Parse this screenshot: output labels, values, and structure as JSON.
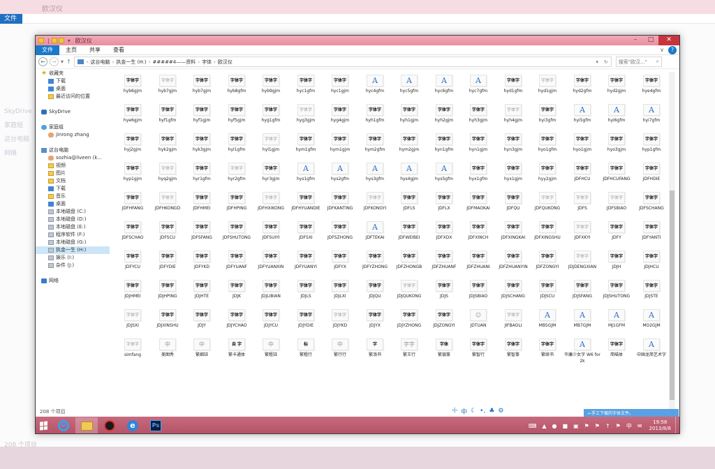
{
  "window": {
    "title": "欧汉仪",
    "controls": {
      "minimize": "–",
      "maximize": "□",
      "close": "✕"
    }
  },
  "ribbon": {
    "tabs": [
      "文件",
      "主页",
      "共享",
      "查看"
    ],
    "help": "?",
    "expand": "∨"
  },
  "address": {
    "crumbs": [
      "这台电脑",
      "执金一生 (H:)",
      "#####4——资料",
      "字体",
      "欧汉仪"
    ],
    "search_placeholder": "搜索\"欧汉...\""
  },
  "nav": {
    "favorites": {
      "label": "收藏夹",
      "items": [
        "下载",
        "桌面",
        "最近访问的位置"
      ]
    },
    "skydrive": "SkyDrive",
    "homegroup": {
      "label": "家庭组",
      "user": "jinrong zhang"
    },
    "thispc": {
      "label": "这台电脑",
      "items": [
        {
          "label": "sozhia@liveen (k...",
          "icon": "user"
        },
        {
          "label": "视频",
          "icon": "folder"
        },
        {
          "label": "图片",
          "icon": "folder"
        },
        {
          "label": "文档",
          "icon": "folder"
        },
        {
          "label": "下载",
          "icon": "blue"
        },
        {
          "label": "音乐",
          "icon": "folder"
        },
        {
          "label": "桌面",
          "icon": "blue"
        },
        {
          "label": "本地磁盘 (C:)",
          "icon": "drive"
        },
        {
          "label": "本地磁盘 (D:)",
          "icon": "drive"
        },
        {
          "label": "本地磁盘 (E:)",
          "icon": "drive"
        },
        {
          "label": "程序软件 (F:)",
          "icon": "drive"
        },
        {
          "label": "本地磁盘 (G:)",
          "icon": "drive"
        },
        {
          "label": "执金一生 (H:)",
          "icon": "drive",
          "selected": true
        },
        {
          "label": "娱乐 (I:)",
          "icon": "drive"
        },
        {
          "label": "杂件 (J:)",
          "icon": "drive"
        }
      ]
    },
    "network": "网络"
  },
  "files": [
    {
      "name": "hyb6gjm",
      "glyph": "字体字",
      "style": "bold"
    },
    {
      "name": "hyb7gjm",
      "glyph": "字体字",
      "style": "gray"
    },
    {
      "name": "hyb7gjm",
      "glyph": "字体字",
      "style": "bold"
    },
    {
      "name": "hyb8gfm",
      "glyph": "字体字",
      "style": "bold"
    },
    {
      "name": "hyb9gjm",
      "glyph": "字体字",
      "style": "bold"
    },
    {
      "name": "hyc1gfm",
      "glyph": "字体字",
      "style": "bold"
    },
    {
      "name": "hyc1gjm",
      "glyph": "字体字",
      "style": "bold"
    },
    {
      "name": "hyc4gfm",
      "glyph": "A",
      "style": "blue"
    },
    {
      "name": "hyc5gfm",
      "glyph": "A",
      "style": "blue"
    },
    {
      "name": "hyc6gfm",
      "glyph": "A",
      "style": "blue"
    },
    {
      "name": "hyc7gfm",
      "glyph": "A",
      "style": "blue"
    },
    {
      "name": "hyd1gfm",
      "glyph": "字体字",
      "style": "bold"
    },
    {
      "name": "hyd1gjm",
      "glyph": "字体字",
      "style": "gray"
    },
    {
      "name": "hyd2gfm",
      "glyph": "字体字",
      "style": "bold"
    },
    {
      "name": "hyd2gjm",
      "glyph": "字体字",
      "style": "bold"
    },
    {
      "name": "hye4gfm",
      "glyph": "字体字",
      "style": "bold"
    },
    {
      "name": "hye6gjm",
      "glyph": "字体字",
      "style": "bold"
    },
    {
      "name": "hyf1gfm",
      "glyph": "字体字",
      "style": "bold"
    },
    {
      "name": "hyf1gjm",
      "glyph": "字体字",
      "style": "bold"
    },
    {
      "name": "hyf5gjm",
      "glyph": "字体字",
      "style": "bold"
    },
    {
      "name": "hyg1gfm",
      "glyph": "字体字",
      "style": "bold"
    },
    {
      "name": "hyg3gjm",
      "glyph": "字体字",
      "style": "gray"
    },
    {
      "name": "hyg4gjm",
      "glyph": "字体字",
      "style": "bold"
    },
    {
      "name": "hyh1gfm",
      "glyph": "字体字",
      "style": "bold"
    },
    {
      "name": "hyh1gjm",
      "glyph": "字体字",
      "style": "bold"
    },
    {
      "name": "hyh2gjm",
      "glyph": "字体字",
      "style": "bold"
    },
    {
      "name": "hyh3gjm",
      "glyph": "字体字",
      "style": "bold"
    },
    {
      "name": "hyh4gjm",
      "glyph": "字体字",
      "style": "gray"
    },
    {
      "name": "hyi3gfm",
      "glyph": "字体字",
      "style": "bold"
    },
    {
      "name": "hyi5gfm",
      "glyph": "A",
      "style": "blue"
    },
    {
      "name": "hyi6gfm",
      "glyph": "A",
      "style": "blue"
    },
    {
      "name": "hyi7gfm",
      "glyph": "A",
      "style": "blue"
    },
    {
      "name": "hyj2gjm",
      "glyph": "字体字",
      "style": "bold"
    },
    {
      "name": "hyk2gjm",
      "glyph": "字体字",
      "style": "bold"
    },
    {
      "name": "hyk3gjm",
      "glyph": "字体字",
      "style": "bold"
    },
    {
      "name": "hyl1gfm",
      "glyph": "字体字",
      "style": "bold"
    },
    {
      "name": "hyl1gjm",
      "glyph": "字体字",
      "style": "gray"
    },
    {
      "name": "hym1gfm",
      "glyph": "字体字",
      "style": "bold"
    },
    {
      "name": "hym1gjm",
      "glyph": "字体字",
      "style": "bold"
    },
    {
      "name": "hym2gfm",
      "glyph": "字体字",
      "style": "bold"
    },
    {
      "name": "hym2gjm",
      "glyph": "字体字",
      "style": "bold"
    },
    {
      "name": "hyn1gfm",
      "glyph": "字体字",
      "style": "bold"
    },
    {
      "name": "hyn1gjm",
      "glyph": "字体字",
      "style": "bold"
    },
    {
      "name": "hyn3gjm",
      "glyph": "字体字",
      "style": "bold"
    },
    {
      "name": "hyo1gfm",
      "glyph": "字体字",
      "style": "bold"
    },
    {
      "name": "hyo1gjm",
      "glyph": "字体字",
      "style": "bold"
    },
    {
      "name": "hyo3gjm",
      "glyph": "字体字",
      "style": "bold"
    },
    {
      "name": "hyp1gfm",
      "glyph": "字体字",
      "style": "bold"
    },
    {
      "name": "hyp1gjm",
      "glyph": "字体字",
      "style": "bold"
    },
    {
      "name": "hyq2gjm",
      "glyph": "字体字",
      "style": "gray"
    },
    {
      "name": "hyr1gfm",
      "glyph": "字体字",
      "style": "bold"
    },
    {
      "name": "hyr2gfm",
      "glyph": "字体字",
      "style": "gray"
    },
    {
      "name": "hyr3gjm",
      "glyph": "字体字",
      "style": "bold"
    },
    {
      "name": "hys1gfm",
      "glyph": "A",
      "style": "blue"
    },
    {
      "name": "hys2gfm",
      "glyph": "A",
      "style": "blue"
    },
    {
      "name": "hys3gfm",
      "glyph": "A",
      "style": "blue"
    },
    {
      "name": "hys4gjm",
      "glyph": "A",
      "style": "blue"
    },
    {
      "name": "hys5gfm",
      "glyph": "A",
      "style": "blue"
    },
    {
      "name": "hyx1gfm",
      "glyph": "字体字",
      "style": "bold"
    },
    {
      "name": "hyx1gjm",
      "glyph": "字体字",
      "style": "bold"
    },
    {
      "name": "hyy2gjm",
      "glyph": "字体字",
      "style": "bold"
    },
    {
      "name": "JDFHCU",
      "glyph": "字体字",
      "style": "bold"
    },
    {
      "name": "JDFHCUFANG",
      "glyph": "字体字",
      "style": "bold"
    },
    {
      "name": "JDFHDIE",
      "glyph": "字体字",
      "style": "bold"
    },
    {
      "name": "JDFHFANG",
      "glyph": "字体字",
      "style": "bold"
    },
    {
      "name": "JDFHKONGD",
      "glyph": "字体字",
      "style": "gray"
    },
    {
      "name": "JDFHMEI",
      "glyph": "字体字",
      "style": "bold"
    },
    {
      "name": "JDFHPING",
      "glyph": "字体字",
      "style": "bold"
    },
    {
      "name": "JDFHXIKONG",
      "glyph": "字体字",
      "style": "gray"
    },
    {
      "name": "JDFHYUANDIE",
      "glyph": "字体字",
      "style": "bold"
    },
    {
      "name": "JDFKANTING",
      "glyph": "字体字",
      "style": "bold"
    },
    {
      "name": "JDFKONGYI",
      "glyph": "字体字",
      "style": "gray"
    },
    {
      "name": "JDFLS",
      "glyph": "字体字",
      "style": "bold"
    },
    {
      "name": "JDFLX",
      "glyph": "字体字",
      "style": "bold"
    },
    {
      "name": "JDFMAOKAI",
      "glyph": "字体字",
      "style": "bold"
    },
    {
      "name": "JDFQU",
      "glyph": "字体字",
      "style": "bold"
    },
    {
      "name": "JDFQUKONG",
      "glyph": "字体字",
      "style": "gray"
    },
    {
      "name": "JDFS",
      "glyph": "字体字",
      "style": "gray"
    },
    {
      "name": "JDFSBIAO",
      "glyph": "字体字",
      "style": "gray"
    },
    {
      "name": "JDFSCHANG",
      "glyph": "字体字",
      "style": "bold"
    },
    {
      "name": "JDFSCHAO",
      "glyph": "字体字",
      "style": "bold"
    },
    {
      "name": "JDFSCU",
      "glyph": "字体字",
      "style": "bold"
    },
    {
      "name": "JDFSFANG",
      "glyph": "字体字",
      "style": "bold"
    },
    {
      "name": "JDFSHUTONG",
      "glyph": "字体字",
      "style": "bold"
    },
    {
      "name": "JDFSUIYI",
      "glyph": "字体字",
      "style": "bold"
    },
    {
      "name": "JDFSXI",
      "glyph": "字体字",
      "style": "bold"
    },
    {
      "name": "JDFSZHONG",
      "glyph": "字体字",
      "style": "bold"
    },
    {
      "name": "JDFTEKAI",
      "glyph": "A",
      "style": "blue"
    },
    {
      "name": "JDFWEIBEI",
      "glyph": "字体字",
      "style": "bold"
    },
    {
      "name": "JDFXDX",
      "glyph": "字体字",
      "style": "bold"
    },
    {
      "name": "JDFXINCH",
      "glyph": "字体字",
      "style": "bold"
    },
    {
      "name": "JDFXINGKAI",
      "glyph": "字体字",
      "style": "bold"
    },
    {
      "name": "JDFXINGSHU",
      "glyph": "字体字",
      "style": "bold"
    },
    {
      "name": "JDFXKYI",
      "glyph": "字体字",
      "style": "gray"
    },
    {
      "name": "JDFY",
      "glyph": "字体字",
      "style": "bold"
    },
    {
      "name": "JDFYANTI",
      "glyph": "字体字",
      "style": "bold"
    },
    {
      "name": "JDFYCU",
      "glyph": "字体字",
      "style": "bold"
    },
    {
      "name": "JDFYDIE",
      "glyph": "字体字",
      "style": "bold"
    },
    {
      "name": "JDFYKD",
      "glyph": "字体字",
      "style": "bold"
    },
    {
      "name": "JDFYUANF",
      "glyph": "字体字",
      "style": "bold"
    },
    {
      "name": "JDFYUANXIN",
      "glyph": "字体字",
      "style": "bold"
    },
    {
      "name": "JDFYUANYI",
      "glyph": "字体字",
      "style": "bold"
    },
    {
      "name": "JDFYX",
      "glyph": "字体字",
      "style": "bold"
    },
    {
      "name": "JDFYZHONG",
      "glyph": "字体字",
      "style": "bold"
    },
    {
      "name": "JDFZHONGB",
      "glyph": "字体字",
      "style": "bold"
    },
    {
      "name": "JDFZHUANF",
      "glyph": "字体字",
      "style": "bold"
    },
    {
      "name": "JDFZHUANI",
      "glyph": "字体字",
      "style": "bold"
    },
    {
      "name": "JDFZHUANYIN",
      "glyph": "字体字",
      "style": "bold"
    },
    {
      "name": "JDFZONGYI",
      "glyph": "字体字",
      "style": "bold"
    },
    {
      "name": "JDJDENGXIAN",
      "glyph": "字体字",
      "style": "gray"
    },
    {
      "name": "JDJH",
      "glyph": "字体字",
      "style": "bold"
    },
    {
      "name": "JDJHCU",
      "glyph": "字体字",
      "style": "bold"
    },
    {
      "name": "JDJHMEI",
      "glyph": "字体字",
      "style": "bold"
    },
    {
      "name": "JDJHPING",
      "glyph": "字体字",
      "style": "bold"
    },
    {
      "name": "JDJHTE",
      "glyph": "字体字",
      "style": "bold"
    },
    {
      "name": "JDJK",
      "glyph": "字体字",
      "style": "bold"
    },
    {
      "name": "JDJLIBIAN",
      "glyph": "字体字",
      "style": "bold"
    },
    {
      "name": "JDJLS",
      "glyph": "字体字",
      "style": "bold"
    },
    {
      "name": "JDJLXI",
      "glyph": "字体字",
      "style": "bold"
    },
    {
      "name": "JDJQU",
      "glyph": "字体字",
      "style": "bold"
    },
    {
      "name": "JDJQUKONG",
      "glyph": "字体字",
      "style": "gray"
    },
    {
      "name": "JDJS",
      "glyph": "字体字",
      "style": "bold"
    },
    {
      "name": "JDJSBIAO",
      "glyph": "字体字",
      "style": "bold"
    },
    {
      "name": "JDJSCHANG",
      "glyph": "字体字",
      "style": "bold"
    },
    {
      "name": "JDJSCU",
      "glyph": "字体字",
      "style": "bold"
    },
    {
      "name": "JDJSFANG",
      "glyph": "字体字",
      "style": "bold"
    },
    {
      "name": "JDJSHUTONG",
      "glyph": "字体字",
      "style": "bold"
    },
    {
      "name": "JDJSTE",
      "glyph": "字体字",
      "style": "bold"
    },
    {
      "name": "JDJSXI",
      "glyph": "字体字",
      "style": "gray"
    },
    {
      "name": "JDJXINSHU",
      "glyph": "字体字",
      "style": "bold"
    },
    {
      "name": "JDJY",
      "glyph": "字体字",
      "style": "bold"
    },
    {
      "name": "JDJYCHAO",
      "glyph": "字体字",
      "style": "bold"
    },
    {
      "name": "JDJYCU",
      "glyph": "字体字",
      "style": "bold"
    },
    {
      "name": "JDJYDIE",
      "glyph": "字体字",
      "style": "bold"
    },
    {
      "name": "JDJYKD",
      "glyph": "字体字",
      "style": "gray"
    },
    {
      "name": "JDJYX",
      "glyph": "字体字",
      "style": "bold"
    },
    {
      "name": "JDJYZHONG",
      "glyph": "字体字",
      "style": "bold"
    },
    {
      "name": "JDJZONGYI",
      "glyph": "字体字",
      "style": "bold"
    },
    {
      "name": "JDTUAN",
      "glyph": "☺",
      "style": "doc"
    },
    {
      "name": "JIFBAOLI",
      "glyph": "字体字",
      "style": "gray"
    },
    {
      "name": "MB5GJM",
      "glyph": "A",
      "style": "blue"
    },
    {
      "name": "MB7GJM",
      "glyph": "A",
      "style": "blue"
    },
    {
      "name": "MJ1GFM",
      "glyph": "A",
      "style": "blue"
    },
    {
      "name": "MO2GJM",
      "glyph": "A",
      "style": "blue"
    },
    {
      "name": "simfang",
      "glyph": "字体字",
      "style": "gray"
    },
    {
      "name": "美图秀",
      "glyph": "中",
      "style": "doc"
    },
    {
      "name": "繁细钰",
      "glyph": "中",
      "style": "doc"
    },
    {
      "name": "繁卡通体",
      "glyph": "自 字",
      "style": "bold"
    },
    {
      "name": "繁粗钰",
      "glyph": "中",
      "style": "doc"
    },
    {
      "name": "繁粗行",
      "glyph": "标",
      "style": "bold"
    },
    {
      "name": "繁行行",
      "glyph": "中",
      "style": "doc"
    },
    {
      "name": "繁淌书",
      "glyph": "字",
      "style": "bold"
    },
    {
      "name": "繁王行",
      "glyph": "字字",
      "style": "doc"
    },
    {
      "name": "繁银篆",
      "glyph": "字体",
      "style": "bold"
    },
    {
      "name": "繁智行",
      "glyph": "字体字",
      "style": "bold"
    },
    {
      "name": "繁智篆",
      "glyph": "字体字",
      "style": "bold"
    },
    {
      "name": "繁续书",
      "glyph": "字体字",
      "style": "bold"
    },
    {
      "name": "华康少女字 W6 for2k",
      "glyph": "A",
      "style": "blue"
    },
    {
      "name": "简喵体",
      "glyph": "字体字",
      "style": "bold"
    },
    {
      "name": "中国龙简艺术字",
      "glyph": "A",
      "style": "blue"
    }
  ],
  "status": {
    "item_count": "208 个项目"
  },
  "ime": [
    "☩",
    "中",
    "☾",
    "•,",
    "♣",
    "⚙"
  ],
  "notification": "←手工下载的字体文件。",
  "taskbar": {
    "tray_icons": [
      "⌨",
      "▲",
      "●",
      "■",
      "▣",
      "⚑",
      "⚑",
      "↑",
      "⚑",
      "中",
      "✉"
    ],
    "time": "19:58",
    "date": "2013/8/8"
  },
  "background": {
    "title": "欧汉仪",
    "tab": "文件",
    "sidebar": [
      "SkyDrive",
      "家庭组",
      "这台电脑",
      "网络"
    ],
    "status": "208 个项目"
  }
}
